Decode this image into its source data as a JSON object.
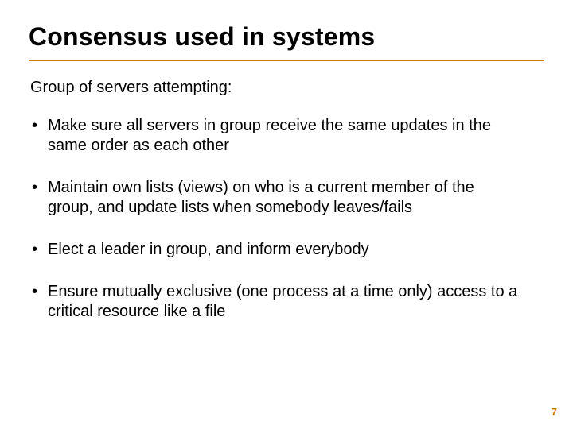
{
  "title": "Consensus used in systems",
  "intro": "Group of servers attempting:",
  "bullets": [
    "Make sure all servers in group receive the same updates in the same order as each other",
    "Maintain own lists (views) on who is a current member of the group, and update lists when somebody leaves/fails",
    "Elect a leader in group, and inform everybody",
    "Ensure mutually exclusive (one process at a time only) access to a critical resource like a file"
  ],
  "page_number": "7"
}
